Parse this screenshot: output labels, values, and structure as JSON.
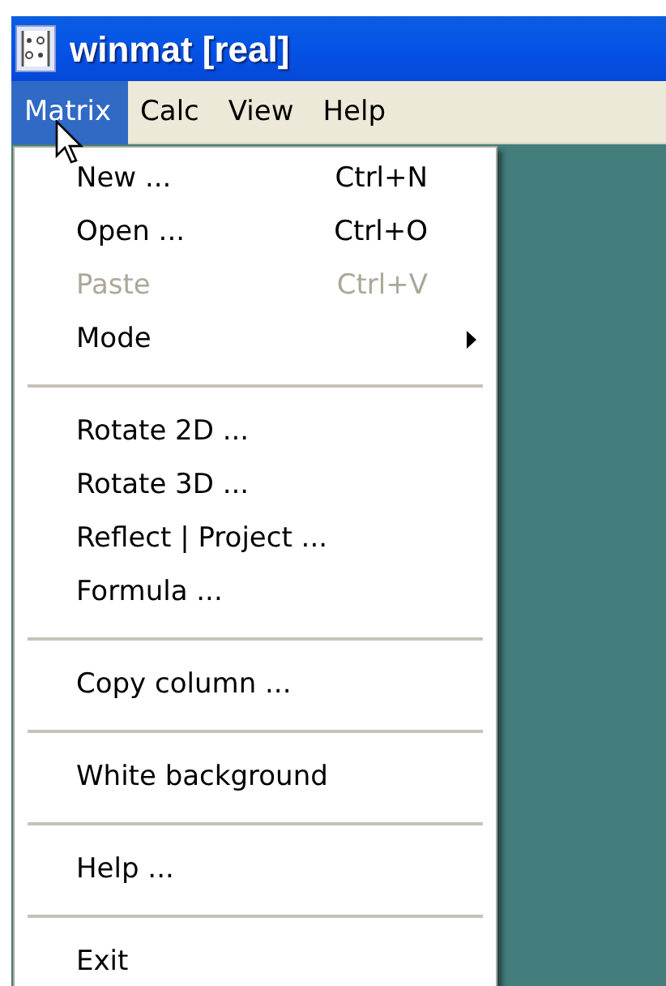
{
  "window": {
    "title": "winmat [real]"
  },
  "menubar": [
    {
      "label": "Matrix",
      "selected": true
    },
    {
      "label": "Calc",
      "selected": false
    },
    {
      "label": "View",
      "selected": false
    },
    {
      "label": "Help",
      "selected": false
    }
  ],
  "menu": [
    {
      "kind": "item",
      "label": "New ...",
      "shortcut": "Ctrl+N",
      "disabled": false
    },
    {
      "kind": "item",
      "label": "Open ...",
      "shortcut": "Ctrl+O",
      "disabled": false
    },
    {
      "kind": "item",
      "label": "Paste",
      "shortcut": "Ctrl+V",
      "disabled": true
    },
    {
      "kind": "submenu",
      "label": "Mode",
      "disabled": false
    },
    {
      "kind": "separator"
    },
    {
      "kind": "item",
      "label": "Rotate 2D ...",
      "disabled": false
    },
    {
      "kind": "item",
      "label": "Rotate 3D ...",
      "disabled": false
    },
    {
      "kind": "item",
      "label": "Reflect | Project ...",
      "disabled": false
    },
    {
      "kind": "item",
      "label": "Formula ...",
      "disabled": false
    },
    {
      "kind": "separator"
    },
    {
      "kind": "item",
      "label": "Copy column ...",
      "disabled": false
    },
    {
      "kind": "separator"
    },
    {
      "kind": "item",
      "label": "White background",
      "disabled": false
    },
    {
      "kind": "separator"
    },
    {
      "kind": "item",
      "label": "Help ...",
      "disabled": false
    },
    {
      "kind": "separator"
    },
    {
      "kind": "item",
      "label": "Exit",
      "disabled": false
    }
  ]
}
